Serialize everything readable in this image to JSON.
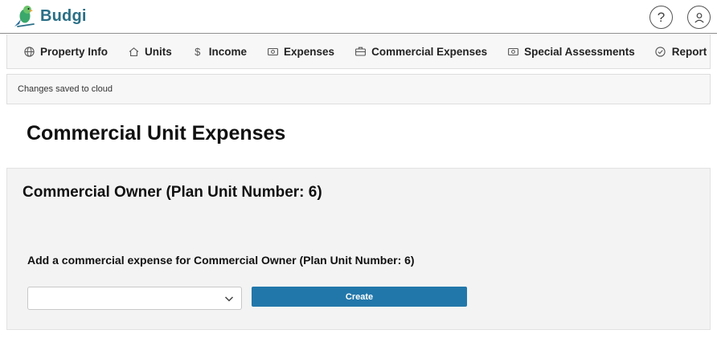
{
  "app": {
    "name": "Budgi"
  },
  "header": {
    "help_icon": "question-circle-icon",
    "help_glyph": "?",
    "user_icon": "user-circle-icon"
  },
  "nav": {
    "items": [
      {
        "label": "Property Info",
        "icon": "globe-icon"
      },
      {
        "label": "Units",
        "icon": "home-icon"
      },
      {
        "label": "Income",
        "icon": "dollar-icon"
      },
      {
        "label": "Expenses",
        "icon": "money-icon"
      },
      {
        "label": "Commercial Expenses",
        "icon": "briefcase-icon"
      },
      {
        "label": "Special Assessments",
        "icon": "money-icon"
      },
      {
        "label": "Report",
        "icon": "check-circle-icon"
      }
    ],
    "dollar_glyph": "$"
  },
  "status": {
    "text": "Changes saved to cloud"
  },
  "page": {
    "title": "Commercial Unit Expenses"
  },
  "card": {
    "owner_title": "Commercial Owner (Plan Unit Number: 6)",
    "add_label": "Add a commercial expense for Commercial Owner (Plan Unit Number: 6)",
    "select_value": "",
    "create_label": "Create"
  },
  "colors": {
    "brand": "#2a6f86",
    "button": "#2277aa",
    "panel": "#f3f3f3",
    "navbar": "#f7f7f7"
  }
}
